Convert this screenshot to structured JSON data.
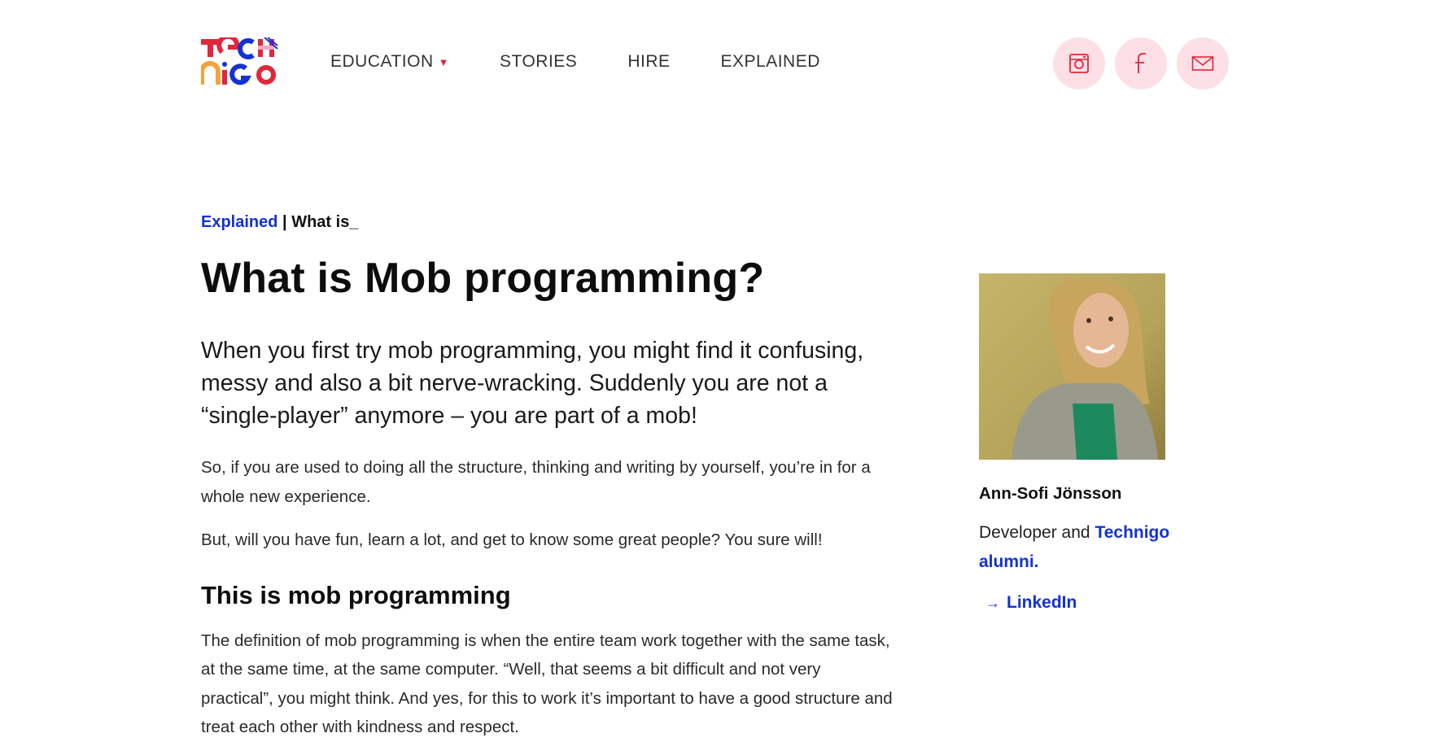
{
  "header": {
    "logo_text": "TECHNIGO",
    "nav": [
      {
        "label": "EDUCATION",
        "has_dropdown": true
      },
      {
        "label": "STORIES"
      },
      {
        "label": "HIRE"
      },
      {
        "label": "EXPLAINED"
      }
    ],
    "social_icons": [
      "instagram-icon",
      "facebook-icon",
      "mail-icon"
    ]
  },
  "breadcrumb": {
    "link": "Explained",
    "separator": " | ",
    "current": "What is_"
  },
  "article": {
    "title": "What is Mob programming?",
    "lead": "When you first try mob programming, you might find it confusing, messy and also a bit nerve-wracking. Suddenly you are not a “single-player” anymore – you are part of a mob!",
    "para1": "So, if you are used to doing all the structure, thinking and writing by yourself, you’re in for a whole new experience.",
    "para2": "But, will you have fun, learn a lot, and get to know some great people? You sure will!",
    "subhead": "This is mob programming",
    "para3": "The definition of mob programming is when the entire team work together with the same task, at the same time, at the same computer. “Well, that seems a bit difficult and not very practical”, you might think. And yes, for this to work it’s important to have a good structure and treat each other with kindness and respect."
  },
  "author": {
    "name": "Ann-Sofi Jönsson",
    "role_prefix": "Developer and ",
    "role_link": "Technigo alumni.",
    "linkedin": "LinkedIn"
  },
  "colors": {
    "accent_blue": "#1432d2",
    "social_bg": "#fde0e6",
    "icon_red": "#e2263b"
  }
}
